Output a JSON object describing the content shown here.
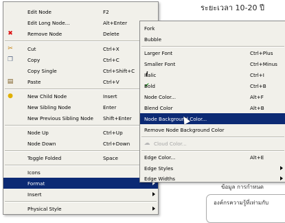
{
  "background": {
    "title_text": "ระยะเวลา 10-20 ปี",
    "line_text": "ข้อมูล การกำหนด",
    "box_text": "องค์กรความรู้ที่เท่ามกับ"
  },
  "main_menu": {
    "items": [
      {
        "label": "Edit Node",
        "shortcut": "F2"
      },
      {
        "label": "Edit Long Node...",
        "shortcut": "Alt+Enter"
      },
      {
        "label": "Remove Node",
        "shortcut": "Delete",
        "icon": "remove-icon"
      },
      {
        "label": "Cut",
        "shortcut": "Ctrl+X",
        "icon": "scissors-icon"
      },
      {
        "label": "Copy",
        "shortcut": "Ctrl+C",
        "icon": "copy-icon"
      },
      {
        "label": "Copy Single",
        "shortcut": "Ctrl+Shift+C"
      },
      {
        "label": "Paste",
        "shortcut": "Ctrl+V",
        "icon": "paste-icon"
      },
      {
        "label": "New Child Node",
        "shortcut": "Insert",
        "icon": "lightbulb-icon"
      },
      {
        "label": "New Sibling Node",
        "shortcut": "Enter"
      },
      {
        "label": "New Previous Sibling Node",
        "shortcut": "Shift+Enter"
      },
      {
        "label": "Node Up",
        "shortcut": "Ctrl+Up"
      },
      {
        "label": "Node Down",
        "shortcut": "Ctrl+Down"
      },
      {
        "label": "Toggle Folded",
        "shortcut": "Space"
      },
      {
        "label": "Icons",
        "submenu": true
      },
      {
        "label": "Format",
        "submenu": true,
        "highlighted": true
      },
      {
        "label": "Insert",
        "submenu": true
      },
      {
        "label": "Physical Style",
        "submenu": true
      }
    ]
  },
  "format_submenu": {
    "items": [
      {
        "label": "Fork"
      },
      {
        "label": "Bubble"
      },
      {
        "label": "Larger Font",
        "shortcut": "Ctrl+Plus"
      },
      {
        "label": "Smaller Font",
        "shortcut": "Ctrl+Minus"
      },
      {
        "label": "Italic",
        "shortcut": "Ctrl+I",
        "icon": "italic-icon"
      },
      {
        "label": "Bold",
        "shortcut": "Ctrl+B",
        "icon": "checkmark-icon"
      },
      {
        "label": "Node Color...",
        "shortcut": "Alt+F"
      },
      {
        "label": "Blend Color",
        "shortcut": "Alt+B"
      },
      {
        "label": "Node Background Color...",
        "highlighted": true
      },
      {
        "label": "Remove Node Background Color"
      },
      {
        "label": "Cloud Color...",
        "disabled": true,
        "icon": "cloud-icon"
      },
      {
        "label": "Edge Color...",
        "shortcut": "Alt+E"
      },
      {
        "label": "Edge Styles",
        "submenu": true
      },
      {
        "label": "Edge Widths",
        "submenu": true
      }
    ]
  },
  "colors": {
    "highlight": "#0c2a74",
    "menu_background": "#f1f0ea",
    "disabled_text": "#a6a6a6"
  }
}
